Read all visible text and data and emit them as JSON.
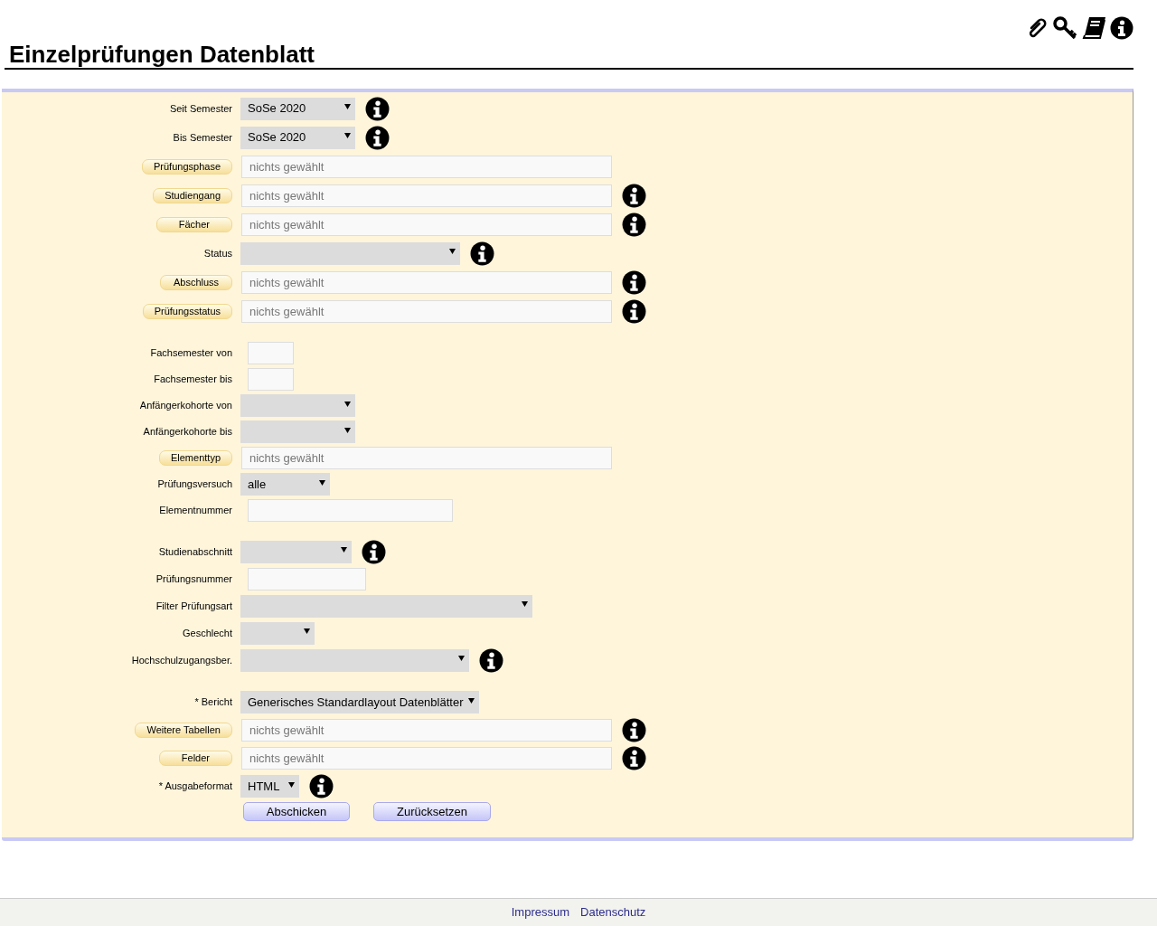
{
  "title": "Einzelprüfungen Datenblatt",
  "sections": [
    {
      "rows": [
        {
          "kind": "select",
          "label": "Seit Semester",
          "value": "SoSe 2020",
          "info": true
        },
        {
          "kind": "select",
          "label": "Bis Semester",
          "value": "SoSe 2020",
          "info": true
        },
        {
          "kind": "picker",
          "label": "Prüfungsphase",
          "placeholder": "nichts gewählt",
          "info": false
        },
        {
          "kind": "picker",
          "label": "Studiengang",
          "placeholder": "nichts gewählt",
          "info": true
        },
        {
          "kind": "picker",
          "label": "Fächer",
          "placeholder": "nichts gewählt",
          "info": true
        },
        {
          "kind": "select",
          "label": "Status",
          "info": true
        },
        {
          "kind": "picker",
          "label": "Abschluss",
          "placeholder": "nichts gewählt",
          "info": true
        },
        {
          "kind": "picker",
          "label": "Prüfungsstatus",
          "placeholder": "nichts gewählt",
          "info": true
        }
      ]
    },
    {
      "rows": [
        {
          "kind": "text",
          "label": "Fachsemester von",
          "info": false
        },
        {
          "kind": "text",
          "label": "Fachsemester bis",
          "info": false
        },
        {
          "kind": "select",
          "label": "Anfängerkohorte von",
          "info": false
        },
        {
          "kind": "select",
          "label": "Anfängerkohorte bis",
          "info": false
        },
        {
          "kind": "picker",
          "label": "Elementtyp",
          "placeholder": "nichts gewählt",
          "info": false
        },
        {
          "kind": "select",
          "label": "Prüfungsversuch",
          "value": "alle",
          "info": false
        },
        {
          "kind": "text",
          "label": "Elementnummer",
          "info": false
        }
      ]
    },
    {
      "rows": [
        {
          "kind": "select",
          "label": "Studienabschnitt",
          "info": true
        },
        {
          "kind": "text",
          "label": "Prüfungsnummer",
          "info": false
        },
        {
          "kind": "select",
          "label": "Filter Prüfungsart",
          "info": false
        },
        {
          "kind": "select",
          "label": "Geschlecht",
          "info": false
        },
        {
          "kind": "select",
          "label": "Hochschulzugangsber.",
          "info": true
        }
      ]
    },
    {
      "rows": [
        {
          "kind": "select",
          "label": "* Bericht",
          "value": "Generisches Standardlayout Datenblätter",
          "info": false
        },
        {
          "kind": "picker",
          "label": "Weitere Tabellen",
          "placeholder": "nichts gewählt",
          "info": true
        },
        {
          "kind": "picker",
          "label": "Felder",
          "placeholder": "nichts gewählt",
          "info": true
        },
        {
          "kind": "select",
          "label": "* Ausgabeformat",
          "value": "HTML",
          "info": true
        }
      ]
    }
  ],
  "buttons": [
    "Abschicken",
    "Zurücksetzen"
  ],
  "footer": [
    "Impressum",
    "Datenschutz"
  ]
}
